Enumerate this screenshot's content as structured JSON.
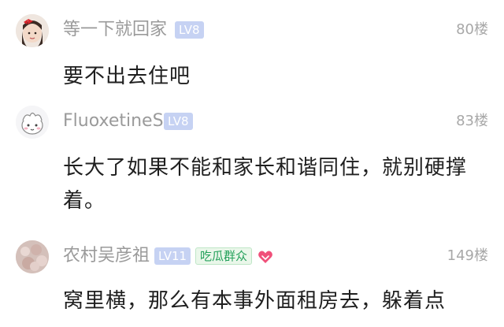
{
  "comments": [
    {
      "username": "等一下就回家",
      "level": "LV8",
      "floor": "80楼",
      "content": "要不出去住吧"
    },
    {
      "username": "FluoxetineS",
      "level": "LV8",
      "floor": "83楼",
      "content": "长大了如果不能和家长和谐同住，就别硬撑着。"
    },
    {
      "username": "农村吴彦祖",
      "level": "LV11",
      "tag": "吃瓜群众",
      "floor": "149楼",
      "content": "窝里横，那么有本事外面租房去，躲着点"
    }
  ],
  "colors": {
    "level_badge_bg": "#c6d2f3",
    "tag_text": "#23a05a",
    "heart": "#f0507a"
  },
  "icons": {
    "heart": "heart-icon"
  }
}
